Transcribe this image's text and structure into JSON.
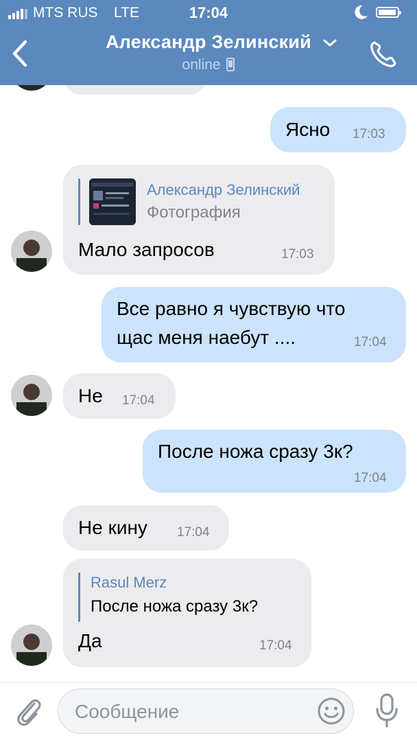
{
  "status_bar": {
    "carrier": "MTS RUS",
    "network": "LTE",
    "time": "17:04"
  },
  "header": {
    "contact_name": "Александр Зелинский",
    "status": "online"
  },
  "messages": [
    {
      "direction": "outgoing",
      "text": "Ясно",
      "time": "17:03"
    },
    {
      "direction": "incoming",
      "reply": {
        "name": "Александр Зелинский",
        "subtitle": "Фотография"
      },
      "text": "Мало запросов",
      "time": "17:03"
    },
    {
      "direction": "outgoing",
      "line1": "Все равно я чувствую что",
      "line2": "щас меня наебут ....",
      "time": "17:04"
    },
    {
      "direction": "incoming",
      "text": "Не",
      "time": "17:04"
    },
    {
      "direction": "outgoing",
      "text": "После ножа сразу 3к?",
      "time": "17:04"
    },
    {
      "direction": "incoming",
      "text": "Не кину",
      "time": "17:04"
    },
    {
      "direction": "incoming",
      "reply": {
        "name": "Rasul Merz",
        "text": "После ножа сразу 3к?"
      },
      "text": "Да",
      "time": "17:04"
    }
  ],
  "composer": {
    "placeholder": "Сообщение"
  },
  "icons": [
    "signal-icon",
    "moon-icon",
    "battery-icon",
    "back-icon",
    "chevron-down-icon",
    "mobile-device-icon",
    "phone-icon",
    "attach-icon",
    "emoji-icon",
    "microphone-icon"
  ],
  "colors": {
    "header": "#5b88bd",
    "incoming_bubble": "#ececef",
    "outgoing_bubble": "#cbe3fc",
    "accent": "#5b88bd"
  }
}
